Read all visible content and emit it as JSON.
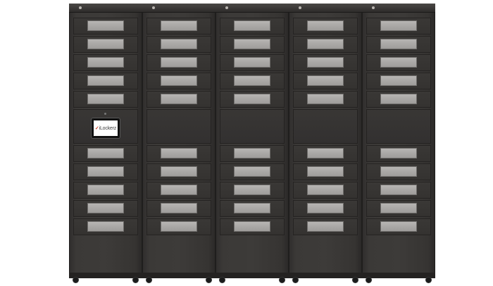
{
  "kiosk": {
    "logo_mark": "✓",
    "logo_text": "iLockerz"
  },
  "colors": {
    "cabinet": "#3b3937",
    "window": "#aeacaa",
    "logo_accent": "#d0442c"
  },
  "cabinets": [
    {
      "name": "cabinet-1",
      "has_kiosk": true,
      "upper_doors": 5,
      "lower_doors": 5
    },
    {
      "name": "cabinet-2",
      "has_kiosk": false,
      "upper_doors": 5,
      "lower_doors": 5
    },
    {
      "name": "cabinet-3",
      "has_kiosk": false,
      "upper_doors": 5,
      "lower_doors": 5
    },
    {
      "name": "cabinet-4",
      "has_kiosk": false,
      "upper_doors": 5,
      "lower_doors": 5
    },
    {
      "name": "cabinet-5",
      "has_kiosk": false,
      "upper_doors": 5,
      "lower_doors": 5
    }
  ]
}
